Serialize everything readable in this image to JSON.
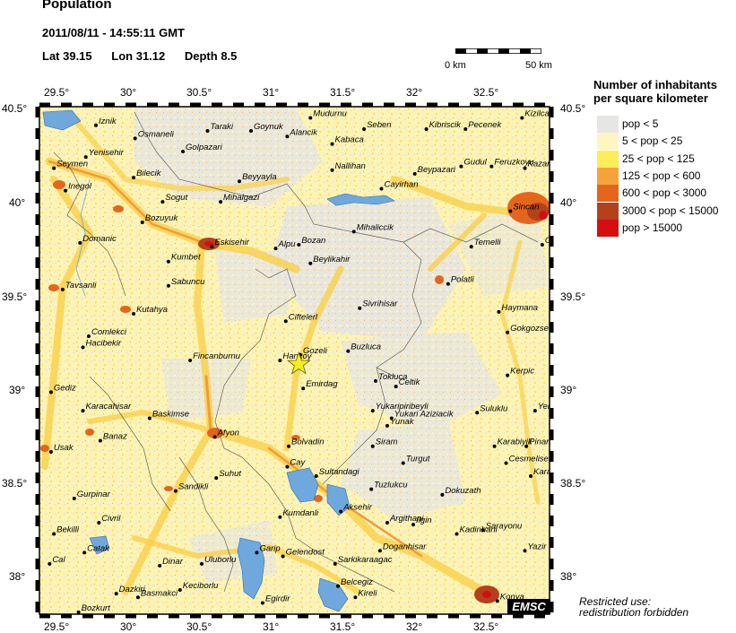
{
  "header": {
    "title": "Population",
    "datetime": "2011/08/11 - 14:55:11 GMT",
    "lat": "Lat 39.15",
    "lon": "Lon 31.12",
    "depth": "Depth 8.5"
  },
  "scale_bar": {
    "left_label": "0 km",
    "right_label": "50 km"
  },
  "lon_ticks": [
    "29.5°",
    "30°",
    "30.5°",
    "31°",
    "31.5°",
    "32°",
    "32.5°"
  ],
  "lat_ticks": [
    "40.5°",
    "40°",
    "39.5°",
    "39°",
    "38.5°",
    "38°"
  ],
  "legend": {
    "title_line1": "Number of inhabitants",
    "title_line2": "per square kilometer",
    "items": [
      {
        "label": "pop < 5",
        "color": "#e6e6e4"
      },
      {
        "label": "5 < pop < 25",
        "color": "#fdf6c3"
      },
      {
        "label": "25 < pop < 125",
        "color": "#fbee58"
      },
      {
        "label": "125 < pop < 600",
        "color": "#f7a33b"
      },
      {
        "label": "600 < pop < 3000",
        "color": "#e4651c"
      },
      {
        "label": "3000 < pop < 15000",
        "color": "#b3411c"
      },
      {
        "label": "pop > 15000",
        "color": "#d40f0f"
      }
    ]
  },
  "epicenter": {
    "lat": 39.15,
    "lon": 31.12,
    "marker": "star-icon",
    "color": "#f4ee22"
  },
  "cities": [
    {
      "name": "Iznik",
      "lon": 29.72,
      "lat": 40.43
    },
    {
      "name": "Taraki",
      "lon": 30.49,
      "lat": 40.4
    },
    {
      "name": "Goynuk",
      "lon": 30.79,
      "lat": 40.4
    },
    {
      "name": "Mudurnu",
      "lon": 31.2,
      "lat": 40.47
    },
    {
      "name": "Seben",
      "lon": 31.57,
      "lat": 40.41
    },
    {
      "name": "Kibriscik",
      "lon": 32.0,
      "lat": 40.41
    },
    {
      "name": "Pecenek",
      "lon": 32.27,
      "lat": 40.41
    },
    {
      "name": "Kizilcahamam",
      "lon": 32.66,
      "lat": 40.47
    },
    {
      "name": "Osmaneli",
      "lon": 29.99,
      "lat": 40.36
    },
    {
      "name": "Alancik",
      "lon": 31.04,
      "lat": 40.37
    },
    {
      "name": "Kabaca",
      "lon": 31.35,
      "lat": 40.33
    },
    {
      "name": "Yenisehir",
      "lon": 29.65,
      "lat": 40.26
    },
    {
      "name": "Golpazari",
      "lon": 30.32,
      "lat": 40.29
    },
    {
      "name": "Gudul",
      "lon": 32.24,
      "lat": 40.21
    },
    {
      "name": "Feruzkoyu",
      "lon": 32.45,
      "lat": 40.21
    },
    {
      "name": "Seymen",
      "lon": 29.43,
      "lat": 40.2
    },
    {
      "name": "Kazan",
      "lon": 32.68,
      "lat": 40.2
    },
    {
      "name": "Nallihan",
      "lon": 31.35,
      "lat": 40.19
    },
    {
      "name": "Beypazari",
      "lon": 31.92,
      "lat": 40.17
    },
    {
      "name": "Bilecik",
      "lon": 29.98,
      "lat": 40.15
    },
    {
      "name": "Beyyayla",
      "lon": 30.71,
      "lat": 40.13
    },
    {
      "name": "Inegol",
      "lon": 29.51,
      "lat": 40.08
    },
    {
      "name": "Cayirhan",
      "lon": 31.69,
      "lat": 40.09
    },
    {
      "name": "Sogut",
      "lon": 30.18,
      "lat": 40.02
    },
    {
      "name": "Mihalgazi",
      "lon": 30.58,
      "lat": 40.02
    },
    {
      "name": "Sincan",
      "lon": 32.58,
      "lat": 39.97
    },
    {
      "name": "Bozuyuk",
      "lon": 30.04,
      "lat": 39.91
    },
    {
      "name": "Mihaliccik",
      "lon": 31.5,
      "lat": 39.86
    },
    {
      "name": "Domanic",
      "lon": 29.61,
      "lat": 39.8
    },
    {
      "name": "Eskisehir",
      "lon": 30.52,
      "lat": 39.78
    },
    {
      "name": "Alpu",
      "lon": 30.96,
      "lat": 39.77
    },
    {
      "name": "Bozan",
      "lon": 31.12,
      "lat": 39.79
    },
    {
      "name": "Temelli",
      "lon": 32.31,
      "lat": 39.78
    },
    {
      "name": "Golbasi",
      "lon": 32.8,
      "lat": 39.79
    },
    {
      "name": "Kumbet",
      "lon": 30.22,
      "lat": 39.7
    },
    {
      "name": "Beylikahir",
      "lon": 31.2,
      "lat": 39.69
    },
    {
      "name": "Polatli",
      "lon": 32.15,
      "lat": 39.58
    },
    {
      "name": "Sabuncu",
      "lon": 30.22,
      "lat": 39.57
    },
    {
      "name": "Tavsanli",
      "lon": 29.49,
      "lat": 39.55
    },
    {
      "name": "Sivrihisar",
      "lon": 31.54,
      "lat": 39.45
    },
    {
      "name": "Haymana",
      "lon": 32.5,
      "lat": 39.43
    },
    {
      "name": "Kutahya",
      "lon": 29.98,
      "lat": 39.42
    },
    {
      "name": "Ciftelerl",
      "lon": 31.03,
      "lat": 39.38
    },
    {
      "name": "Comlekci",
      "lon": 29.67,
      "lat": 39.3
    },
    {
      "name": "Gokgozse",
      "lon": 32.56,
      "lat": 39.32
    },
    {
      "name": "Hacibekir",
      "lon": 29.63,
      "lat": 39.24
    },
    {
      "name": "Buzluca",
      "lon": 31.46,
      "lat": 39.22
    },
    {
      "name": "Gozeli",
      "lon": 31.13,
      "lat": 39.2
    },
    {
      "name": "Fincanburnu",
      "lon": 30.37,
      "lat": 39.17
    },
    {
      "name": "Hankoy",
      "lon": 30.99,
      "lat": 39.17
    },
    {
      "name": "Kerpic",
      "lon": 32.56,
      "lat": 39.09
    },
    {
      "name": "Tokluca",
      "lon": 31.65,
      "lat": 39.06
    },
    {
      "name": "Emirdag",
      "lon": 31.15,
      "lat": 39.02
    },
    {
      "name": "Celtik",
      "lon": 31.79,
      "lat": 39.03
    },
    {
      "name": "Gediz",
      "lon": 29.41,
      "lat": 39.0
    },
    {
      "name": "Yukaripiribeyli",
      "lon": 31.63,
      "lat": 38.9
    },
    {
      "name": "Karacahisar",
      "lon": 29.63,
      "lat": 38.9
    },
    {
      "name": "Suluklu",
      "lon": 32.35,
      "lat": 38.89
    },
    {
      "name": "Yeniyurt",
      "lon": 32.75,
      "lat": 38.9
    },
    {
      "name": "Baskimse",
      "lon": 30.09,
      "lat": 38.86
    },
    {
      "name": "Yukari Aziziacik",
      "lon": 31.76,
      "lat": 38.86
    },
    {
      "name": "Yunak",
      "lon": 31.73,
      "lat": 38.82
    },
    {
      "name": "Banaz",
      "lon": 29.75,
      "lat": 38.74
    },
    {
      "name": "Afyon",
      "lon": 30.54,
      "lat": 38.76
    },
    {
      "name": "Bolvadin",
      "lon": 31.05,
      "lat": 38.71
    },
    {
      "name": "Siram",
      "lon": 31.63,
      "lat": 38.71
    },
    {
      "name": "Karabiyik",
      "lon": 32.47,
      "lat": 38.71
    },
    {
      "name": "Pinarbasi",
      "lon": 32.69,
      "lat": 38.71
    },
    {
      "name": "Usak",
      "lon": 29.41,
      "lat": 38.68
    },
    {
      "name": "Turgut",
      "lon": 31.84,
      "lat": 38.62
    },
    {
      "name": "Cesmelisebil",
      "lon": 32.55,
      "lat": 38.62
    },
    {
      "name": "Cay",
      "lon": 31.04,
      "lat": 38.6
    },
    {
      "name": "Sultandagi",
      "lon": 31.24,
      "lat": 38.55
    },
    {
      "name": "Karapinar",
      "lon": 32.72,
      "lat": 38.55
    },
    {
      "name": "Suhut",
      "lon": 30.55,
      "lat": 38.54
    },
    {
      "name": "Sandikli",
      "lon": 30.27,
      "lat": 38.47
    },
    {
      "name": "Tuzlukcu",
      "lon": 31.62,
      "lat": 38.48
    },
    {
      "name": "Dokuzath",
      "lon": 32.11,
      "lat": 38.45
    },
    {
      "name": "Gurpinar",
      "lon": 29.57,
      "lat": 38.43
    },
    {
      "name": "Aksehir",
      "lon": 31.41,
      "lat": 38.36
    },
    {
      "name": "Kumdanli",
      "lon": 30.99,
      "lat": 38.33
    },
    {
      "name": "Sarayonu",
      "lon": 32.39,
      "lat": 38.26
    },
    {
      "name": "Argithani",
      "lon": 31.73,
      "lat": 38.3
    },
    {
      "name": "Ilgin",
      "lon": 31.91,
      "lat": 38.29
    },
    {
      "name": "Civril",
      "lon": 29.74,
      "lat": 38.3
    },
    {
      "name": "Kadinhani",
      "lon": 32.21,
      "lat": 38.24
    },
    {
      "name": "Bekilli",
      "lon": 29.43,
      "lat": 38.24
    },
    {
      "name": "Catak",
      "lon": 29.64,
      "lat": 38.14
    },
    {
      "name": "Garip",
      "lon": 30.83,
      "lat": 38.14
    },
    {
      "name": "Gelendost",
      "lon": 31.01,
      "lat": 38.12
    },
    {
      "name": "Doganhisar",
      "lon": 31.68,
      "lat": 38.15
    },
    {
      "name": "Yazir",
      "lon": 32.68,
      "lat": 38.15
    },
    {
      "name": "Cal",
      "lon": 29.4,
      "lat": 38.08
    },
    {
      "name": "Dinar",
      "lon": 30.16,
      "lat": 38.07
    },
    {
      "name": "Uluborlu",
      "lon": 30.45,
      "lat": 38.08
    },
    {
      "name": "Sarkikaraagac",
      "lon": 31.37,
      "lat": 38.08
    },
    {
      "name": "Belcegiz",
      "lon": 31.39,
      "lat": 37.96
    },
    {
      "name": "Kireli",
      "lon": 31.51,
      "lat": 37.9
    },
    {
      "name": "Keciborlu",
      "lon": 30.3,
      "lat": 37.94
    },
    {
      "name": "Basmakci",
      "lon": 30.01,
      "lat": 37.9
    },
    {
      "name": "Dazkiri",
      "lon": 29.86,
      "lat": 37.92
    },
    {
      "name": "Egirdir",
      "lon": 30.87,
      "lat": 37.87
    },
    {
      "name": "Konya",
      "lon": 32.49,
      "lat": 37.88
    },
    {
      "name": "Bozkurt",
      "lon": 29.6,
      "lat": 37.82
    }
  ],
  "lakes": [
    "Beysehir Lake",
    "Egirdir Lake",
    "Aksehir Lake",
    "Eber Lake",
    "Iznik Lake",
    "Sariyar Reservoir"
  ],
  "restricted": {
    "line1": "Restricted use:",
    "line2": "redistribution forbidden"
  },
  "emsc_logo": "EMSC"
}
